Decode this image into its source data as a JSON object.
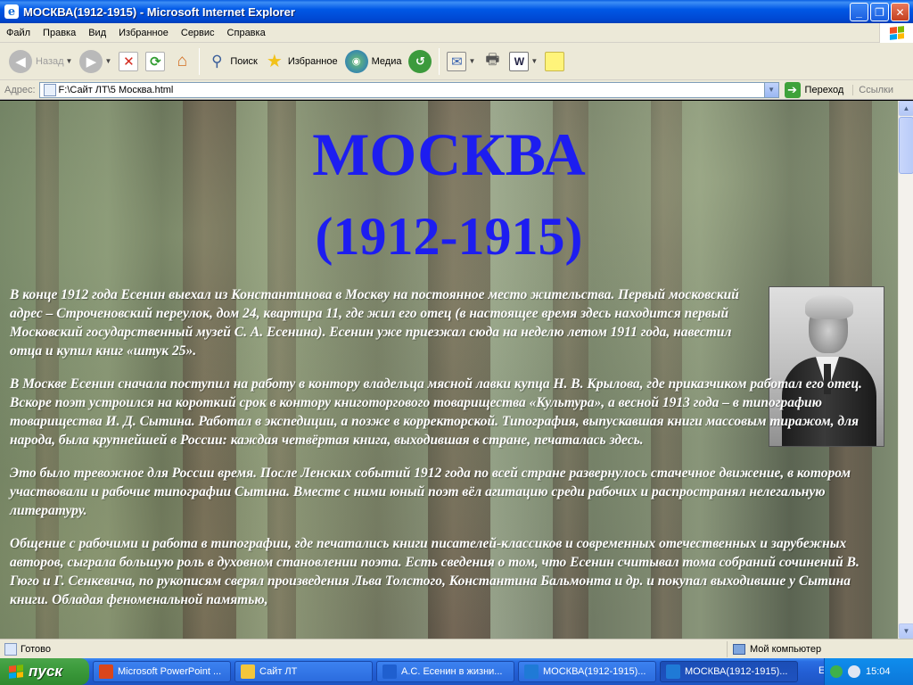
{
  "window": {
    "title": "МОСКВА(1912-1915) - Microsoft Internet Explorer",
    "icon_name": "ie-icon"
  },
  "menu": [
    "Файл",
    "Правка",
    "Вид",
    "Избранное",
    "Сервис",
    "Справка"
  ],
  "toolbar": {
    "back": "Назад",
    "search": "Поиск",
    "favorites": "Избранное",
    "media": "Медиа"
  },
  "address": {
    "label": "Адрес:",
    "value": "F:\\Сайт ЛТ\\5 Москва.html",
    "go": "Переход",
    "links": "Ссылки"
  },
  "page": {
    "title_line1": "МОСКВА",
    "title_line2": "(1912-1915)",
    "paragraphs": [
      "В конце 1912 года Есенин выехал из Константинова в Москву на постоянное место жительства. Первый московский адрес – Строченовский переулок, дом 24, квартира 11, где жил его отец (в настоящее время здесь находится первый Московский государственный музей С. А. Есенина). Есенин уже приезжал сюда на неделю летом 1911 года, навестил отца и купил книг «штук 25».",
      "В Москве Есенин сначала поступил на работу в контору владельца мясной лавки купца Н. В. Крылова, где приказчиком работал его отец. Вскоре поэт устроился на короткий срок в контору книготоргового товарищества «Культура», а весной 1913 года – в типографию товарищества И. Д. Сытина. Работал в экспедиции, а позже в корректорской. Типография, выпускавшая книги массовым тиражом, для народа, была крупнейшей в России: каждая четвёртая книга, выходившая в стране, печаталась здесь.",
      "Это было тревожное для России время. После Ленских событий 1912 года по всей стране развернулось стачечное движение, в котором участвовали и рабочие типографии Сытина. Вместе с ними юный поэт вёл агитацию среди рабочих и распространял нелегальную литературу.",
      "Общение с рабочими и работа в типографии, где печатались книги писателей-классиков и современных отечественных и зарубежных авторов, сыграла большую роль в духовном становлении поэта. Есть сведения о том, что Есенин считывал тома собраний сочинений В. Гюго и Г. Сенкевича, по рукописям сверял произведения Льва Толстого, Константина Бальмонта и др. и покупал выходившие у Сытина книги. Обладая феноменальной памятью,"
    ]
  },
  "status": {
    "text": "Готово",
    "zone": "Мой компьютер"
  },
  "taskbar": {
    "start": "пуск",
    "tasks": [
      {
        "label": "Microsoft PowerPoint ...",
        "icon_color": "#d9461c",
        "active": false
      },
      {
        "label": "Сайт ЛТ",
        "icon_color": "#f3c63c",
        "active": false
      },
      {
        "label": "А.С. Есенин в жизни...",
        "icon_color": "#1f5fcf",
        "active": false
      },
      {
        "label": "МОСКВА(1912-1915)...",
        "icon_color": "#1f7ad6",
        "active": false
      },
      {
        "label": "МОСКВА(1912-1915)...",
        "icon_color": "#1f7ad6",
        "active": true
      }
    ],
    "lang": "EN",
    "clock": "15:04"
  }
}
